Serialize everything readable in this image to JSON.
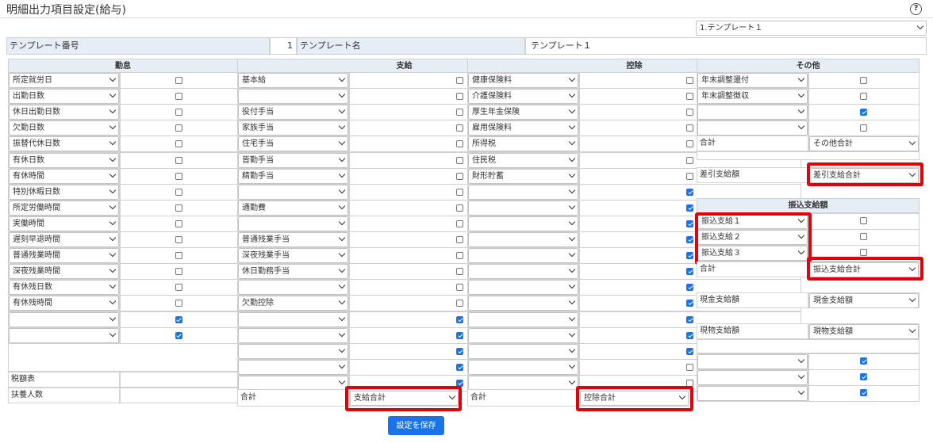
{
  "page": {
    "title": "明細出力項目設定(給与)",
    "help_glyph": "?",
    "save_label": "設定を保存"
  },
  "template_select": "1.テンプレート１",
  "template": {
    "num_label": "テンプレート番号",
    "num_value": "1",
    "name_label": "テンプレート名",
    "name_value": "テンプレート１"
  },
  "kintai": {
    "header": "勤怠",
    "rows": [
      {
        "label": "所定就労日",
        "checked": false
      },
      {
        "label": "出勤日数",
        "checked": false
      },
      {
        "label": "休日出勤日数",
        "checked": false
      },
      {
        "label": "欠勤日数",
        "checked": false
      },
      {
        "label": "振替代休日数",
        "checked": false
      },
      {
        "label": "有休日数",
        "checked": false
      },
      {
        "label": "有休時間",
        "checked": false
      },
      {
        "label": "特別休暇日数",
        "checked": false
      },
      {
        "label": "所定労働時間",
        "checked": false
      },
      {
        "label": "実働時間",
        "checked": false
      },
      {
        "label": "遅刻早退時間",
        "checked": false
      },
      {
        "label": "普通残業時間",
        "checked": false
      },
      {
        "label": "深夜残業時間",
        "checked": false
      },
      {
        "label": "有休残日数",
        "checked": false
      },
      {
        "label": "有休残時間",
        "checked": false
      },
      {
        "label": "",
        "checked": true
      },
      {
        "label": "",
        "checked": true
      }
    ],
    "tax_table_label": "税額表",
    "dependents_label": "扶養人数"
  },
  "shikyu": {
    "header": "支給",
    "rows": [
      {
        "label": "基本給",
        "checked": false
      },
      {
        "label": "",
        "checked": false
      },
      {
        "label": "役付手当",
        "checked": false
      },
      {
        "label": "家族手当",
        "checked": false
      },
      {
        "label": "住宅手当",
        "checked": false
      },
      {
        "label": "皆勤手当",
        "checked": false
      },
      {
        "label": "精勤手当",
        "checked": false
      },
      {
        "label": "",
        "checked": false
      },
      {
        "label": "通勤費",
        "checked": false
      },
      {
        "label": "",
        "checked": false
      },
      {
        "label": "普通残業手当",
        "checked": false
      },
      {
        "label": "深夜残業手当",
        "checked": false
      },
      {
        "label": "休日勤務手当",
        "checked": false
      },
      {
        "label": "",
        "checked": false
      },
      {
        "label": "欠勤控除",
        "checked": false
      },
      {
        "label": "",
        "checked": true
      },
      {
        "label": "",
        "checked": true
      },
      {
        "label": "",
        "checked": true
      },
      {
        "label": "",
        "checked": true
      },
      {
        "label": "",
        "checked": true
      }
    ],
    "total_label": "合計",
    "total_select": "支給合計"
  },
  "kojo": {
    "header": "控除",
    "rows": [
      {
        "label": "健康保険料",
        "checked": false
      },
      {
        "label": "介護保険料",
        "checked": false
      },
      {
        "label": "厚生年金保険",
        "checked": false
      },
      {
        "label": "雇用保険料",
        "checked": false
      },
      {
        "label": "所得税",
        "checked": false
      },
      {
        "label": "住民税",
        "checked": false
      },
      {
        "label": "財形貯蓄",
        "checked": false
      },
      {
        "label": "",
        "checked": true
      },
      {
        "label": "",
        "checked": true
      },
      {
        "label": "",
        "checked": true
      },
      {
        "label": "",
        "checked": true
      },
      {
        "label": "",
        "checked": true
      },
      {
        "label": "",
        "checked": true
      },
      {
        "label": "",
        "checked": true
      },
      {
        "label": "",
        "checked": true
      },
      {
        "label": "",
        "checked": true
      },
      {
        "label": "",
        "checked": true
      },
      {
        "label": "",
        "checked": true
      },
      {
        "label": "",
        "checked": false
      },
      {
        "label": "",
        "checked": false
      }
    ],
    "total_label": "合計",
    "total_select": "控除合計"
  },
  "sonota": {
    "header": "その他",
    "rows": [
      {
        "label": "年末調整還付",
        "checked": false
      },
      {
        "label": "年末調整徴収",
        "checked": false
      },
      {
        "label": "",
        "checked": true
      },
      {
        "label": "",
        "checked": false
      }
    ],
    "total_label": "合計",
    "total_select": "その他合計",
    "sashihiki_label": "差引支給額",
    "sashihiki_select": "差引支給合計",
    "furikomi_header": "振込支給額",
    "furikomi_rows": [
      {
        "label": "振込支給１",
        "checked": false
      },
      {
        "label": "振込支給２",
        "checked": false
      },
      {
        "label": "振込支給３",
        "checked": false
      }
    ],
    "furikomi_total_label": "合計",
    "furikomi_total_select": "振込支給合計",
    "genkin_label": "現金支給額",
    "genkin_select": "現金支給額",
    "genbutsu_label": "現物支給額",
    "genbutsu_select": "現物支給額",
    "extra_rows": [
      {
        "label": "",
        "checked": true
      },
      {
        "label": "",
        "checked": true
      },
      {
        "label": "",
        "checked": true
      }
    ]
  },
  "colors": {
    "header_bg": "#e6edf5",
    "accent": "#1a73e8",
    "highlight": "#e0000b"
  }
}
